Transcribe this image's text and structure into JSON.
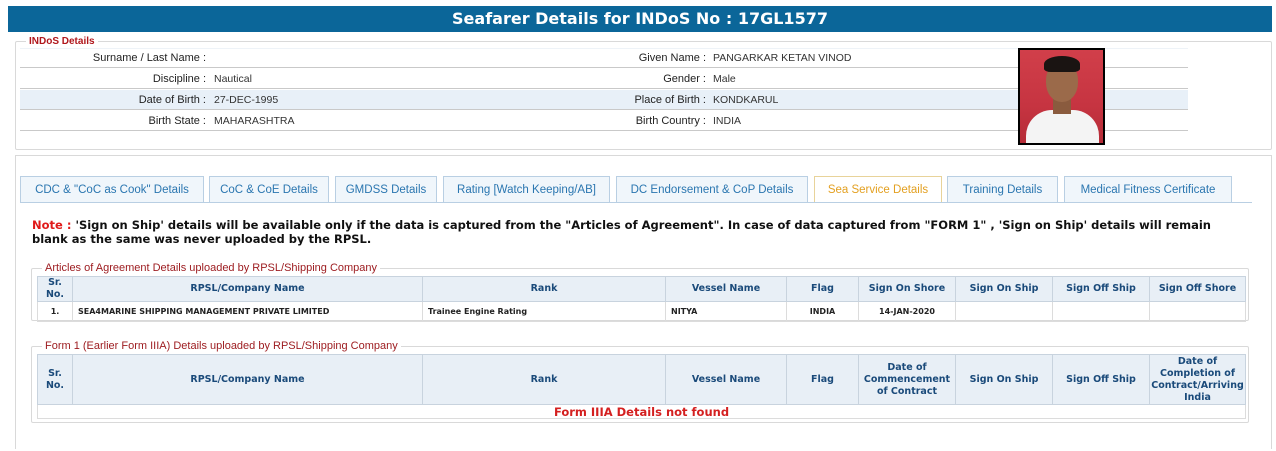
{
  "page_title": "Seafarer Details for INDoS No : 17GL1577",
  "indos": {
    "legend": "INDoS Details",
    "rows": [
      {
        "label1": "Surname / Last Name :",
        "value1": "",
        "label2": "Given Name :",
        "value2": "PANGARKAR KETAN VINOD"
      },
      {
        "label1": "Discipline :",
        "value1": "Nautical",
        "label2": "Gender :",
        "value2": "Male"
      },
      {
        "label1": "Date of Birth :",
        "value1": "27-DEC-1995",
        "label2": "Place of Birth :",
        "value2": "KONDKARUL"
      },
      {
        "label1": "Birth State :",
        "value1": "MAHARASHTRA",
        "label2": "Birth Country :",
        "value2": "INDIA"
      }
    ]
  },
  "tabs": [
    {
      "label": "CDC & \"CoC as Cook\" Details",
      "active": false
    },
    {
      "label": "CoC & CoE Details",
      "active": false
    },
    {
      "label": "GMDSS Details",
      "active": false
    },
    {
      "label": "Rating [Watch Keeping/AB]",
      "active": false
    },
    {
      "label": "DC Endorsement & CoP Details",
      "active": false
    },
    {
      "label": "Sea Service Details",
      "active": true
    },
    {
      "label": "Training Details",
      "active": false
    },
    {
      "label": "Medical Fitness Certificate",
      "active": false
    }
  ],
  "note": {
    "prefix": "Note :",
    "text": " 'Sign on Ship' details will be available only if the data is captured from the \"Articles of Agreement\". In case of data captured from \"FORM 1\" , 'Sign on Ship' details will remain blank as the same was never uploaded by the RPSL."
  },
  "articles": {
    "legend": "Articles of Agreement Details uploaded by RPSL/Shipping Company",
    "headers": [
      "Sr. No.",
      "RPSL/Company Name",
      "Rank",
      "Vessel Name",
      "Flag",
      "Sign On Shore",
      "Sign On Ship",
      "Sign Off Ship",
      "Sign Off Shore"
    ],
    "rows": [
      [
        "1.",
        "SEA4MARINE SHIPPING MANAGEMENT PRIVATE LIMITED",
        "Trainee Engine Rating",
        "NITYA",
        "INDIA",
        "14-JAN-2020",
        "",
        "",
        ""
      ]
    ]
  },
  "form1": {
    "legend": "Form 1 (Earlier Form IIIA) Details uploaded by RPSL/Shipping Company",
    "headers": [
      "Sr. No.",
      "RPSL/Company Name",
      "Rank",
      "Vessel Name",
      "Flag",
      "Date of Commencement of Contract",
      "Sign On Ship",
      "Sign Off Ship",
      "Date of Completion of Contract/Arriving India"
    ],
    "empty_message": "Form IIIA Details not found"
  },
  "colors": {
    "title_bar": "#0b6699",
    "active_tab": "#e3a021",
    "tab_text": "#2a76b0",
    "legend_red": "#b0161b",
    "not_found_red": "#d42020"
  }
}
